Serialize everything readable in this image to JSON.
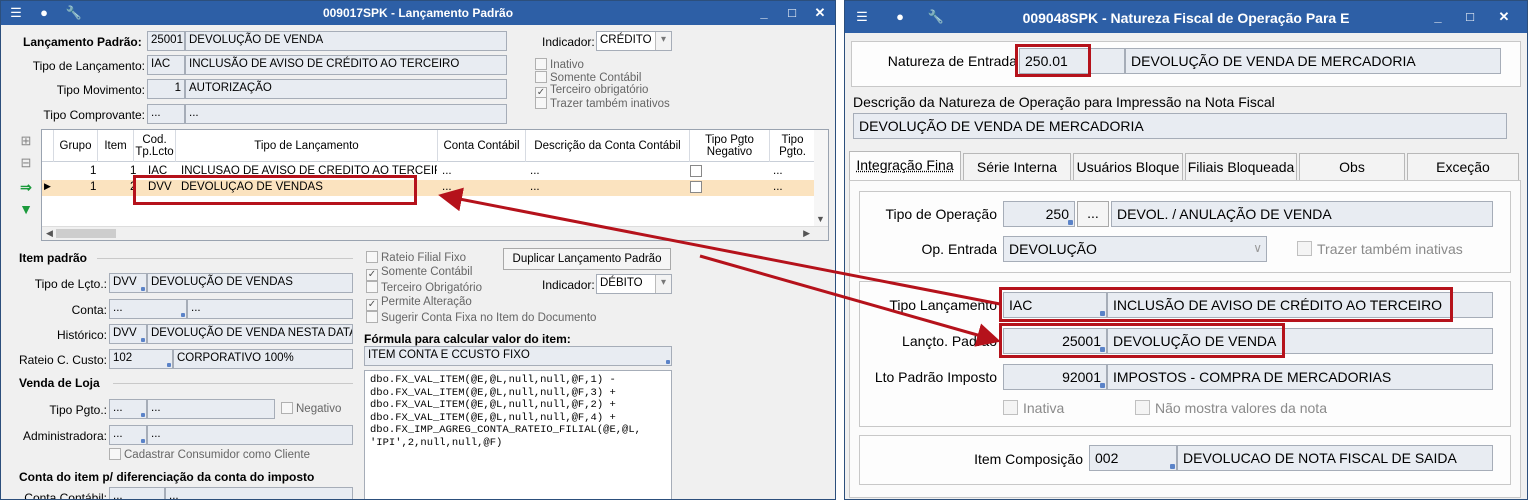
{
  "left_window": {
    "title": "009017SPK - Lançamento Padrão",
    "controls": {
      "minimize": "_",
      "maximize": "□",
      "close": "✕"
    },
    "header": {
      "lancamento_padrao_label": "Lançamento Padrão:",
      "lancamento_padrao_code": "25001",
      "lancamento_padrao_desc": "DEVOLUÇÃO DE VENDA",
      "indicador_label": "Indicador:",
      "indicador_value": "CRÉDITO",
      "tipo_lancamento_label": "Tipo de Lançamento:",
      "tipo_lancamento_code": "IAC",
      "tipo_lancamento_desc": "INCLUSÃO DE AVISO DE CRÉDITO AO TERCEIRO",
      "tipo_movimento_label": "Tipo Movimento:",
      "tipo_movimento_code": "1",
      "tipo_movimento_desc": "AUTORIZAÇÃO",
      "tipo_comprovante_label": "Tipo Comprovante:",
      "tipo_comprovante_code": "...",
      "tipo_comprovante_desc": "..."
    },
    "checkboxes_top": [
      {
        "label": "Inativo",
        "checked": false
      },
      {
        "label": "Somente Contábil",
        "checked": false
      },
      {
        "label": "Terceiro obrigatório",
        "checked": true
      },
      {
        "label": "Trazer também inativos",
        "checked": false
      }
    ],
    "grid": {
      "columns": [
        "Grupo",
        "Item",
        "Cod. Tp.Lcto",
        "Tipo de Lançamento",
        "Conta Contábil",
        "Descrição da Conta Contábil",
        "Tipo Pgto Negativo",
        "Tipo Pgto."
      ],
      "rows": [
        {
          "grupo": "1",
          "item": "1",
          "cod": "IAC",
          "tipo": "INCLUSÃO DE AVISO DE CRÉDITO AO TERCEIRO",
          "conta": "...",
          "desc": "...",
          "pgto": "..."
        },
        {
          "grupo": "1",
          "item": "2",
          "cod": "DVV",
          "tipo": "DEVOLUÇÃO DE VENDAS",
          "conta": "...",
          "desc": "...",
          "pgto": "..."
        }
      ]
    },
    "item_padrao": {
      "section_label": "Item padrão",
      "tipo_lcto_label": "Tipo de Lçto.:",
      "tipo_lcto_code": "DVV",
      "tipo_lcto_desc": "DEVOLUÇÃO DE VENDAS",
      "conta_label": "Conta:",
      "conta_code": "...",
      "conta_desc": "...",
      "historico_label": "Histórico:",
      "historico_code": "DVV",
      "historico_desc": "DEVOLUÇÃO DE VENDA NESTA DATA",
      "rateio_label": "Rateio C. Custo:",
      "rateio_code": "102",
      "rateio_desc": "CORPORATIVO 100%"
    },
    "checkboxes_mid": [
      {
        "label": "Rateio Filial Fixo",
        "checked": false
      },
      {
        "label": "Somente Contábil",
        "checked": true
      },
      {
        "label": "Terceiro Obrigatório",
        "checked": false
      },
      {
        "label": "Permite Alteração",
        "checked": true
      },
      {
        "label": "Sugerir Conta Fixa no Item do Documento",
        "checked": false
      }
    ],
    "duplicar_button": "Duplicar Lançamento Padrão",
    "indicador2_label": "Indicador:",
    "indicador2_value": "DÉBITO",
    "formula_label": "Fórmula para calcular valor do item:",
    "formula_name": "ITEM CONTA E CCUSTO FIXO",
    "formula_code": "dbo.FX_VAL_ITEM(@E,@L,null,null,@F,1) -\ndbo.FX_VAL_ITEM(@E,@L,null,null,@F,3) +\ndbo.FX_VAL_ITEM(@E,@L,null,null,@F,2) +\ndbo.FX_VAL_ITEM(@E,@L,null,null,@F,4) +\ndbo.FX_IMP_AGREG_CONTA_RATEIO_FILIAL(@E,@L,\n'IPI',2,null,null,@F)",
    "venda_loja": {
      "section_label": "Venda de Loja",
      "tipo_pgto_label": "Tipo Pgto.:",
      "tipo_pgto_code": "...",
      "tipo_pgto_desc": "...",
      "negativo_label": "Negativo",
      "administradora_label": "Administradora:",
      "administradora_code": "...",
      "administradora_desc": "...",
      "cadastrar_label": "Cadastrar Consumidor como Cliente"
    },
    "conta_imposto": {
      "section_label": "Conta do item p/ diferenciação da conta do imposto",
      "conta_contabil_label": "Conta Contábil:",
      "conta_contabil_code": "...",
      "conta_contabil_desc": "..."
    }
  },
  "right_window": {
    "title": "009048SPK - Natureza Fiscal de Operação Para E",
    "controls": {
      "minimize": "_",
      "maximize": "□",
      "close": "✕"
    },
    "natureza_entrada_label": "Natureza de Entrada",
    "natureza_entrada_code": "250.01",
    "natureza_entrada_desc": "DEVOLUÇÃO DE VENDA DE MERCADORIA",
    "descricao_label": "Descrição da Natureza de Operação para Impressão na Nota Fiscal",
    "descricao_value": "DEVOLUÇÃO DE VENDA DE MERCADORIA",
    "tabs": [
      "Integração Fina",
      "Série Interna",
      "Usuários Bloque",
      "Filiais Bloqueada",
      "Obs",
      "Exceção"
    ],
    "tipo_operacao_label": "Tipo de Operação",
    "tipo_operacao_code": "250",
    "tipo_operacao_btn": "...",
    "tipo_operacao_desc": "DEVOL. / ANULAÇÃO DE VENDA",
    "op_entrada_label": "Op. Entrada",
    "op_entrada_value": "DEVOLUÇÃO",
    "trazer_inativas_label": "Trazer também inativas",
    "tipo_lancamento_label": "Tipo Lançamento",
    "tipo_lancamento_code": "IAC",
    "tipo_lancamento_desc": "INCLUSÃO DE AVISO DE CRÉDITO AO TERCEIRO",
    "lancto_padrao_label": "Lançto. Padrão",
    "lancto_padrao_code": "25001",
    "lancto_padrao_desc": "DEVOLUÇÃO DE VENDA",
    "lto_imposto_label": "Lto Padrão Imposto",
    "lto_imposto_code": "92001",
    "lto_imposto_desc": "IMPOSTOS - COMPRA DE MERCADORIAS",
    "inativa_label": "Inativa",
    "nao_mostra_label": "Não mostra valores da nota",
    "item_composicao_label": "Item Composição",
    "item_composicao_code": "002",
    "item_composicao_desc": "DEVOLUCAO DE NOTA FISCAL DE SAIDA"
  },
  "colors": {
    "titlebar": "#2d5fa6",
    "highlight": "#b5121b",
    "selected_row": "#fbe3bf"
  }
}
